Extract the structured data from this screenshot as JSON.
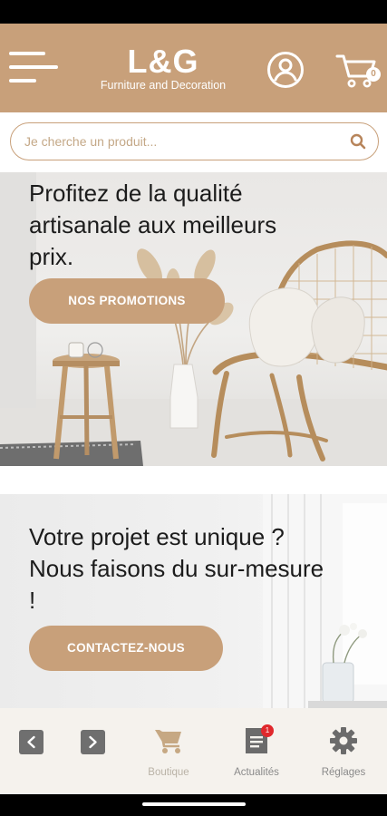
{
  "header": {
    "brand": "L&G",
    "tagline": "Furniture and Decoration",
    "cart_count": "0"
  },
  "search": {
    "placeholder": "Je cherche un produit..."
  },
  "banners": [
    {
      "title": "Profitez de la qualité artisanale aux meilleurs prix.",
      "button": "NOS PROMOTIONS"
    },
    {
      "title": "Votre projet est unique ? Nous faisons du sur-mesure !",
      "button": "CONTACTEZ-NOUS"
    }
  ],
  "bottom_nav": {
    "items": [
      {
        "label": "Boutique",
        "icon": "cart-icon"
      },
      {
        "label": "Actualités",
        "icon": "news-icon",
        "badge": "1"
      },
      {
        "label": "Réglages",
        "icon": "gear-icon"
      }
    ]
  },
  "colors": {
    "brand": "#c8a07a",
    "nav_bg": "#f5f2ed",
    "badge": "#e0282c"
  }
}
